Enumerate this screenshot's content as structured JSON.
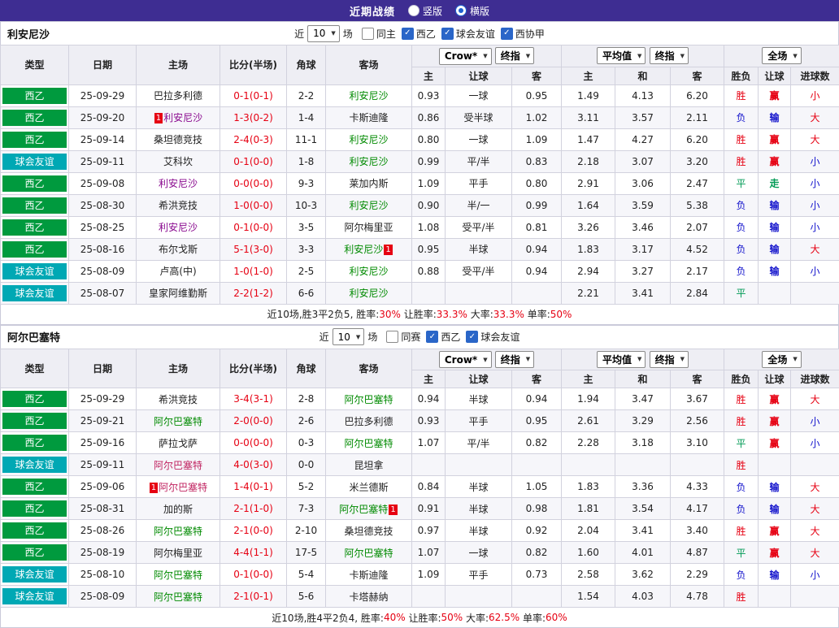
{
  "topbar": {
    "title": "近期战绩",
    "radios": [
      {
        "label": "竖版",
        "selected": false
      },
      {
        "label": "横版",
        "selected": true
      }
    ]
  },
  "header": {
    "cols": [
      "类型",
      "日期",
      "主场",
      "比分(半场)",
      "角球",
      "客场"
    ],
    "selects": {
      "crow": "Crow*",
      "stage1": "终指",
      "avg": "平均值",
      "stage2": "终指",
      "full": "全场"
    },
    "subcols": [
      "主",
      "让球",
      "客",
      "主",
      "和",
      "客",
      "胜负",
      "让球",
      "进球数"
    ]
  },
  "palette": {
    "topbar_bg": "#3e2d92",
    "league_green": "#009a3e",
    "friendly_teal": "#00a8b4",
    "score_red": "#e60012",
    "lose_blue": "#1414cc",
    "draw_green": "#009a55",
    "team_green": "#008a00",
    "team_purple": "#8a0a8f"
  },
  "sections": [
    {
      "team": "利安尼沙",
      "filter": {
        "near": "近",
        "count": "10",
        "games": "场",
        "checks": [
          {
            "label": "同主",
            "checked": false
          },
          {
            "label": "西乙",
            "checked": true
          },
          {
            "label": "球会友谊",
            "checked": true
          },
          {
            "label": "西协甲",
            "checked": true
          }
        ]
      },
      "rows": [
        {
          "type": "西乙",
          "tc": "green",
          "date": "25-09-29",
          "home": {
            "n": "巴拉多利德"
          },
          "score": "0-1(0-1)",
          "corner": "2-2",
          "away": {
            "n": "利安尼沙",
            "c": "green"
          },
          "odds": [
            "0.93",
            "一球",
            "0.95"
          ],
          "avg": [
            "1.49",
            "4.13",
            "6.20"
          ],
          "res": [
            [
              "胜",
              "red"
            ],
            [
              "赢",
              "red"
            ],
            [
              "小",
              "red"
            ]
          ]
        },
        {
          "type": "西乙",
          "tc": "green",
          "date": "25-09-20",
          "home": {
            "n": "利安尼沙",
            "c": "purple",
            "pre": "1"
          },
          "score": "1-3(0-2)",
          "corner": "1-4",
          "away": {
            "n": "卡斯迪隆"
          },
          "odds": [
            "0.86",
            "受半球",
            "1.02"
          ],
          "avg": [
            "3.11",
            "3.57",
            "2.11"
          ],
          "res": [
            [
              "负",
              "blue"
            ],
            [
              "输",
              "blue"
            ],
            [
              "大",
              "red"
            ]
          ]
        },
        {
          "type": "西乙",
          "tc": "green",
          "date": "25-09-14",
          "home": {
            "n": "桑坦德竞技"
          },
          "score": "2-4(0-3)",
          "corner": "11-1",
          "away": {
            "n": "利安尼沙",
            "c": "green"
          },
          "odds": [
            "0.80",
            "一球",
            "1.09"
          ],
          "avg": [
            "1.47",
            "4.27",
            "6.20"
          ],
          "res": [
            [
              "胜",
              "red"
            ],
            [
              "赢",
              "red"
            ],
            [
              "大",
              "red"
            ]
          ]
        },
        {
          "type": "球会友谊",
          "tc": "teal",
          "date": "25-09-11",
          "home": {
            "n": "艾科坎"
          },
          "score": "0-1(0-0)",
          "corner": "1-8",
          "away": {
            "n": "利安尼沙",
            "c": "green"
          },
          "odds": [
            "0.99",
            "平/半",
            "0.83"
          ],
          "avg": [
            "2.18",
            "3.07",
            "3.20"
          ],
          "res": [
            [
              "胜",
              "red"
            ],
            [
              "赢",
              "red"
            ],
            [
              "小",
              "blue"
            ]
          ]
        },
        {
          "type": "西乙",
          "tc": "green",
          "date": "25-09-08",
          "home": {
            "n": "利安尼沙",
            "c": "purple"
          },
          "score": "0-0(0-0)",
          "corner": "9-3",
          "away": {
            "n": "莱加内斯"
          },
          "odds": [
            "1.09",
            "平手",
            "0.80"
          ],
          "avg": [
            "2.91",
            "3.06",
            "2.47"
          ],
          "res": [
            [
              "平",
              "green"
            ],
            [
              "走",
              "green"
            ],
            [
              "小",
              "blue"
            ]
          ]
        },
        {
          "type": "西乙",
          "tc": "green",
          "date": "25-08-30",
          "home": {
            "n": "希洪竞技"
          },
          "score": "1-0(0-0)",
          "corner": "10-3",
          "away": {
            "n": "利安尼沙",
            "c": "green"
          },
          "odds": [
            "0.90",
            "半/一",
            "0.99"
          ],
          "avg": [
            "1.64",
            "3.59",
            "5.38"
          ],
          "res": [
            [
              "负",
              "blue"
            ],
            [
              "输",
              "blue"
            ],
            [
              "小",
              "blue"
            ]
          ]
        },
        {
          "type": "西乙",
          "tc": "green",
          "date": "25-08-25",
          "home": {
            "n": "利安尼沙",
            "c": "purple"
          },
          "score": "0-1(0-0)",
          "corner": "3-5",
          "away": {
            "n": "阿尔梅里亚"
          },
          "odds": [
            "1.08",
            "受平/半",
            "0.81"
          ],
          "avg": [
            "3.26",
            "3.46",
            "2.07"
          ],
          "res": [
            [
              "负",
              "blue"
            ],
            [
              "输",
              "blue"
            ],
            [
              "小",
              "blue"
            ]
          ]
        },
        {
          "type": "西乙",
          "tc": "green",
          "date": "25-08-16",
          "home": {
            "n": "布尔戈斯"
          },
          "score": "5-1(3-0)",
          "corner": "3-3",
          "away": {
            "n": "利安尼沙",
            "c": "green",
            "post": "1"
          },
          "odds": [
            "0.95",
            "半球",
            "0.94"
          ],
          "avg": [
            "1.83",
            "3.17",
            "4.52"
          ],
          "res": [
            [
              "负",
              "blue"
            ],
            [
              "输",
              "blue"
            ],
            [
              "大",
              "red"
            ]
          ]
        },
        {
          "type": "球会友谊",
          "tc": "teal",
          "date": "25-08-09",
          "home": {
            "n": "卢高(中)"
          },
          "score": "1-0(1-0)",
          "corner": "2-5",
          "away": {
            "n": "利安尼沙",
            "c": "green"
          },
          "odds": [
            "0.88",
            "受平/半",
            "0.94"
          ],
          "avg": [
            "2.94",
            "3.27",
            "2.17"
          ],
          "res": [
            [
              "负",
              "blue"
            ],
            [
              "输",
              "blue"
            ],
            [
              "小",
              "blue"
            ]
          ]
        },
        {
          "type": "球会友谊",
          "tc": "teal",
          "date": "25-08-07",
          "home": {
            "n": "皇家阿维勤斯"
          },
          "score": "2-2(1-2)",
          "corner": "6-6",
          "away": {
            "n": "利安尼沙",
            "c": "green"
          },
          "odds": [
            "",
            "",
            ""
          ],
          "avg": [
            "2.21",
            "3.41",
            "2.84"
          ],
          "res": [
            [
              "平",
              "green"
            ],
            [
              "",
              ""
            ],
            [
              "",
              ""
            ]
          ]
        }
      ],
      "summary": [
        {
          "t": "近10场,胜3平2负5, 胜率:",
          "c": "black"
        },
        {
          "t": "30%",
          "c": "red"
        },
        {
          "t": " 让胜率:",
          "c": "black"
        },
        {
          "t": "33.3%",
          "c": "red"
        },
        {
          "t": " 大率:",
          "c": "black"
        },
        {
          "t": "33.3%",
          "c": "red"
        },
        {
          "t": " 单率:",
          "c": "black"
        },
        {
          "t": "50%",
          "c": "red"
        }
      ]
    },
    {
      "team": "阿尔巴塞特",
      "filter": {
        "near": "近",
        "count": "10",
        "games": "场",
        "checks": [
          {
            "label": "同赛",
            "checked": false
          },
          {
            "label": "西乙",
            "checked": true
          },
          {
            "label": "球会友谊",
            "checked": true
          }
        ]
      },
      "rows": [
        {
          "type": "西乙",
          "tc": "green",
          "date": "25-09-29",
          "home": {
            "n": "希洪竞技"
          },
          "score": "3-4(3-1)",
          "corner": "2-8",
          "away": {
            "n": "阿尔巴塞特",
            "c": "green"
          },
          "odds": [
            "0.94",
            "半球",
            "0.94"
          ],
          "avg": [
            "1.94",
            "3.47",
            "3.67"
          ],
          "res": [
            [
              "胜",
              "red"
            ],
            [
              "赢",
              "red"
            ],
            [
              "大",
              "red"
            ]
          ]
        },
        {
          "type": "西乙",
          "tc": "green",
          "date": "25-09-21",
          "home": {
            "n": "阿尔巴塞特",
            "c": "green"
          },
          "score": "2-0(0-0)",
          "corner": "2-6",
          "away": {
            "n": "巴拉多利德"
          },
          "odds": [
            "0.93",
            "平手",
            "0.95"
          ],
          "avg": [
            "2.61",
            "3.29",
            "2.56"
          ],
          "res": [
            [
              "胜",
              "red"
            ],
            [
              "赢",
              "red"
            ],
            [
              "小",
              "blue"
            ]
          ]
        },
        {
          "type": "西乙",
          "tc": "green",
          "date": "25-09-16",
          "home": {
            "n": "萨拉戈萨"
          },
          "score": "0-0(0-0)",
          "corner": "0-3",
          "away": {
            "n": "阿尔巴塞特",
            "c": "green"
          },
          "odds": [
            "1.07",
            "平/半",
            "0.82"
          ],
          "avg": [
            "2.28",
            "3.18",
            "3.10"
          ],
          "res": [
            [
              "平",
              "green"
            ],
            [
              "赢",
              "red"
            ],
            [
              "小",
              "blue"
            ]
          ]
        },
        {
          "type": "球会友谊",
          "tc": "teal",
          "date": "25-09-11",
          "home": {
            "n": "阿尔巴塞特",
            "c": "maroon"
          },
          "score": "4-0(3-0)",
          "corner": "0-0",
          "away": {
            "n": "昆坦拿"
          },
          "odds": [
            "",
            "",
            ""
          ],
          "avg": [
            "",
            "",
            ""
          ],
          "res": [
            [
              "胜",
              "red"
            ],
            [
              "",
              ""
            ],
            [
              "",
              ""
            ]
          ]
        },
        {
          "type": "西乙",
          "tc": "green",
          "date": "25-09-06",
          "home": {
            "n": "阿尔巴塞特",
            "c": "maroon",
            "pre": "1"
          },
          "score": "1-4(0-1)",
          "corner": "5-2",
          "away": {
            "n": "米兰德斯"
          },
          "odds": [
            "0.84",
            "半球",
            "1.05"
          ],
          "avg": [
            "1.83",
            "3.36",
            "4.33"
          ],
          "res": [
            [
              "负",
              "blue"
            ],
            [
              "输",
              "blue"
            ],
            [
              "大",
              "red"
            ]
          ]
        },
        {
          "type": "西乙",
          "tc": "green",
          "date": "25-08-31",
          "home": {
            "n": "加的斯"
          },
          "score": "2-1(1-0)",
          "corner": "7-3",
          "away": {
            "n": "阿尔巴塞特",
            "c": "green",
            "post": "1"
          },
          "odds": [
            "0.91",
            "半球",
            "0.98"
          ],
          "avg": [
            "1.81",
            "3.54",
            "4.17"
          ],
          "res": [
            [
              "负",
              "blue"
            ],
            [
              "输",
              "blue"
            ],
            [
              "大",
              "red"
            ]
          ]
        },
        {
          "type": "西乙",
          "tc": "green",
          "date": "25-08-26",
          "home": {
            "n": "阿尔巴塞特",
            "c": "green"
          },
          "score": "2-1(0-0)",
          "corner": "2-10",
          "away": {
            "n": "桑坦德竞技"
          },
          "odds": [
            "0.97",
            "半球",
            "0.92"
          ],
          "avg": [
            "2.04",
            "3.41",
            "3.40"
          ],
          "res": [
            [
              "胜",
              "red"
            ],
            [
              "赢",
              "red"
            ],
            [
              "大",
              "red"
            ]
          ]
        },
        {
          "type": "西乙",
          "tc": "green",
          "date": "25-08-19",
          "home": {
            "n": "阿尔梅里亚"
          },
          "score": "4-4(1-1)",
          "corner": "17-5",
          "away": {
            "n": "阿尔巴塞特",
            "c": "green"
          },
          "odds": [
            "1.07",
            "一球",
            "0.82"
          ],
          "avg": [
            "1.60",
            "4.01",
            "4.87"
          ],
          "res": [
            [
              "平",
              "green"
            ],
            [
              "赢",
              "red"
            ],
            [
              "大",
              "red"
            ]
          ]
        },
        {
          "type": "球会友谊",
          "tc": "teal",
          "date": "25-08-10",
          "home": {
            "n": "阿尔巴塞特",
            "c": "green"
          },
          "score": "0-1(0-0)",
          "corner": "5-4",
          "away": {
            "n": "卡斯迪隆"
          },
          "odds": [
            "1.09",
            "平手",
            "0.73"
          ],
          "avg": [
            "2.58",
            "3.62",
            "2.29"
          ],
          "res": [
            [
              "负",
              "blue"
            ],
            [
              "输",
              "blue"
            ],
            [
              "小",
              "blue"
            ]
          ]
        },
        {
          "type": "球会友谊",
          "tc": "teal",
          "date": "25-08-09",
          "home": {
            "n": "阿尔巴塞特",
            "c": "green"
          },
          "score": "2-1(0-1)",
          "corner": "5-6",
          "away": {
            "n": "卡塔赫纳"
          },
          "odds": [
            "",
            "",
            ""
          ],
          "avg": [
            "1.54",
            "4.03",
            "4.78"
          ],
          "res": [
            [
              "胜",
              "red"
            ],
            [
              "",
              ""
            ],
            [
              "",
              ""
            ]
          ]
        }
      ],
      "summary": [
        {
          "t": "近10场,胜4平2负4, 胜率:",
          "c": "black"
        },
        {
          "t": "40%",
          "c": "red"
        },
        {
          "t": " 让胜率:",
          "c": "black"
        },
        {
          "t": "50%",
          "c": "red"
        },
        {
          "t": " 大率:",
          "c": "black"
        },
        {
          "t": "62.5%",
          "c": "red"
        },
        {
          "t": " 单率:",
          "c": "black"
        },
        {
          "t": "60%",
          "c": "red"
        }
      ]
    }
  ]
}
